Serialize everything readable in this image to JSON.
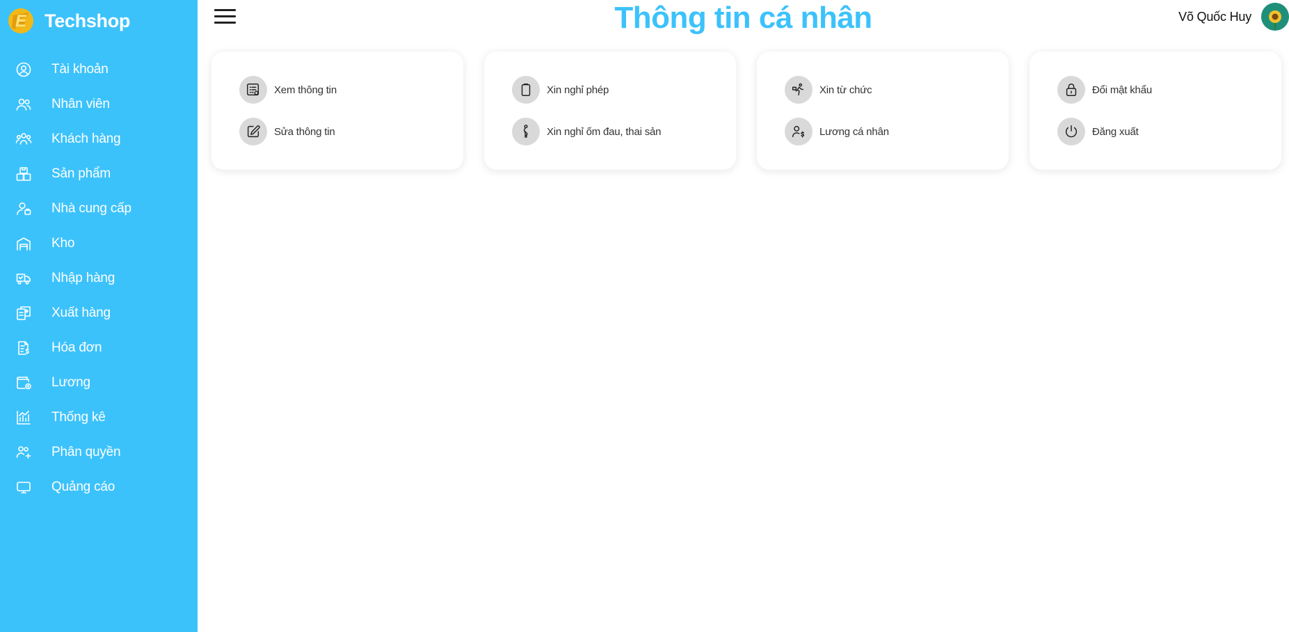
{
  "app": {
    "name": "Techshop"
  },
  "colors": {
    "sidebar": "#3cc2fb",
    "title": "#3cc2fb",
    "icon_bg": "#d9d9d9"
  },
  "sidebar": {
    "items": [
      {
        "label": "Tài khoản",
        "icon": "user-circle-icon"
      },
      {
        "label": "Nhân viên",
        "icon": "users-icon"
      },
      {
        "label": "Khách hàng",
        "icon": "group-icon"
      },
      {
        "label": "Sản phẩm",
        "icon": "boxes-icon"
      },
      {
        "label": "Nhà cung cấp",
        "icon": "supplier-icon"
      },
      {
        "label": "Kho",
        "icon": "warehouse-icon"
      },
      {
        "label": "Nhập hàng",
        "icon": "truck-in-icon"
      },
      {
        "label": "Xuất hàng",
        "icon": "export-icon"
      },
      {
        "label": "Hóa đơn",
        "icon": "invoice-icon"
      },
      {
        "label": "Lương",
        "icon": "wallet-icon"
      },
      {
        "label": "Thống kê",
        "icon": "chart-icon"
      },
      {
        "label": "Phân quyền",
        "icon": "user-permission-icon"
      },
      {
        "label": "Quảng cáo",
        "icon": "monitor-icon"
      }
    ]
  },
  "header": {
    "title": "Thông tin cá nhân",
    "user_name": "Võ Quốc Huy"
  },
  "cards": [
    {
      "items": [
        {
          "label": "Xem thông tin",
          "icon": "view-info-icon"
        },
        {
          "label": "Sửa thông tin",
          "icon": "edit-icon"
        }
      ]
    },
    {
      "items": [
        {
          "label": "Xin nghỉ phép",
          "icon": "clipboard-icon"
        },
        {
          "label": "Xin nghỉ ốm đau, thai sản",
          "icon": "pregnant-icon"
        }
      ]
    },
    {
      "items": [
        {
          "label": "Xin từ chức",
          "icon": "resign-icon"
        },
        {
          "label": "Lương cá nhân",
          "icon": "salary-icon"
        }
      ]
    },
    {
      "items": [
        {
          "label": "Đổi mật khẩu",
          "icon": "lock-icon"
        },
        {
          "label": "Đăng xuất",
          "icon": "power-icon"
        }
      ]
    }
  ]
}
